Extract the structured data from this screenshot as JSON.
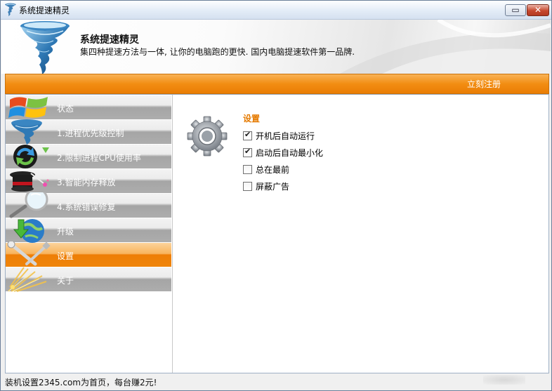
{
  "window": {
    "title": "系统提速精灵",
    "min_glyph": "▭",
    "close_glyph": "✕"
  },
  "header": {
    "app_name": "系统提速精灵",
    "slogan": "集四种提速方法与一体, 让你的电脑跑的更快. 国内电脑提速软件第一品牌."
  },
  "toolbar": {
    "register_label": "立刻注册",
    "accent_color": "#f28d12"
  },
  "sidebar": {
    "items": [
      {
        "label": "状态",
        "icon": "windows-logo-icon",
        "active": false
      },
      {
        "label": "1.进程优先级控制",
        "icon": "tornado-icon",
        "active": false
      },
      {
        "label": "2.限制进程CPU使用率",
        "icon": "refresh-arrows-icon",
        "active": false
      },
      {
        "label": "3.智能内存释放",
        "icon": "magic-hat-icon",
        "active": false
      },
      {
        "label": "4.系统错误修复",
        "icon": "magnifier-icon",
        "active": false
      },
      {
        "label": "升级",
        "icon": "globe-download-icon",
        "active": false
      },
      {
        "label": "设置",
        "icon": "tools-icon",
        "active": true
      },
      {
        "label": "关于",
        "icon": "sparkle-icon",
        "active": false
      }
    ]
  },
  "settings": {
    "title": "设置",
    "icon": "gear-icon",
    "options": [
      {
        "label": "开机后自动运行",
        "checked": true
      },
      {
        "label": "启动后自动最小化",
        "checked": true
      },
      {
        "label": "总在最前",
        "checked": false
      },
      {
        "label": "屏蔽广告",
        "checked": false
      }
    ],
    "check_glyph": "✔"
  },
  "status": {
    "ad_text": "装机设置2345.com为首页，每台赚2元!"
  }
}
